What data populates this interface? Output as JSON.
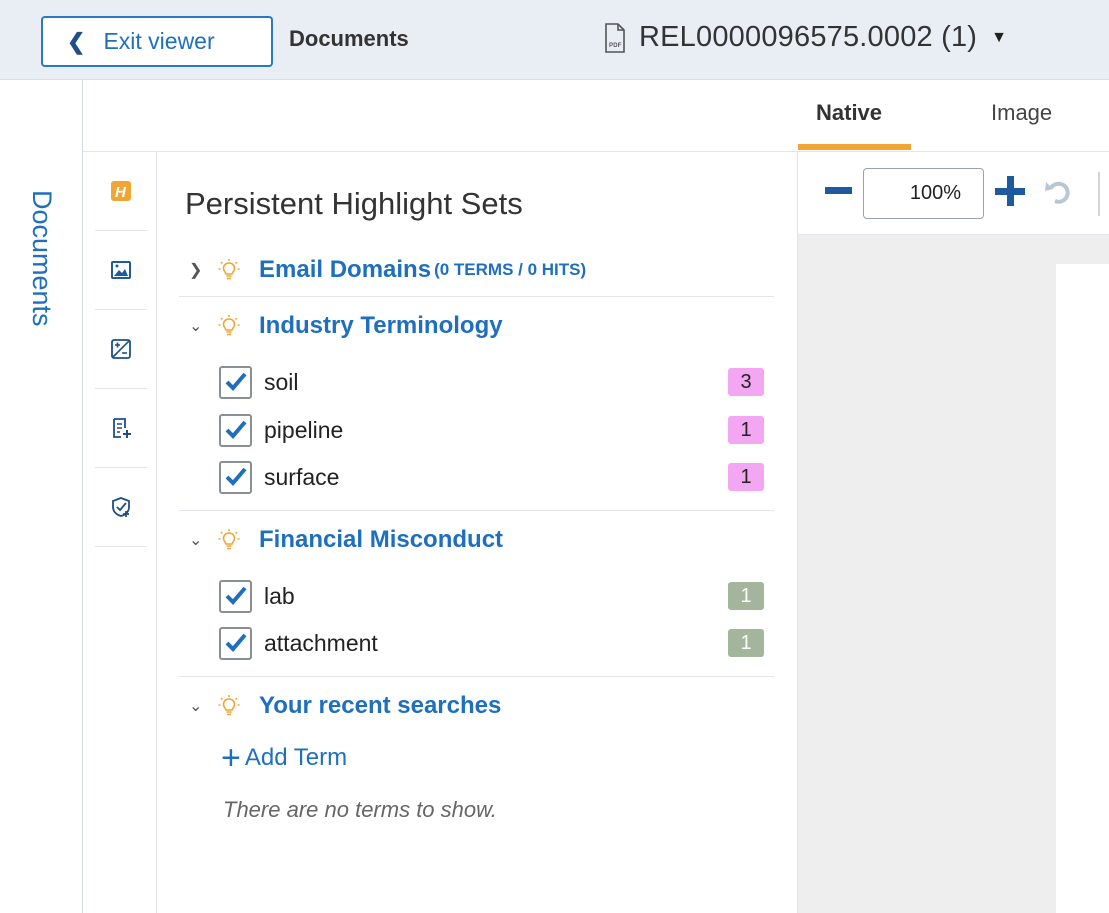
{
  "header": {
    "exit_label": "Exit viewer",
    "breadcrumb": "Documents",
    "doc_title": "REL0000096575.0002 (1)"
  },
  "side_tab": {
    "label": "Documents"
  },
  "panel": {
    "title": "Persistent Highlight Sets",
    "sections": [
      {
        "name": "Email Domains",
        "meta": "(0 TERMS / 0 HITS)",
        "expanded": false,
        "terms": []
      },
      {
        "name": "Industry Terminology",
        "meta": "",
        "expanded": true,
        "terms": [
          {
            "label": "soil",
            "count": "3",
            "badge_color": "#f3a6f1"
          },
          {
            "label": "pipeline",
            "count": "1",
            "badge_color": "#f3a6f1"
          },
          {
            "label": "surface",
            "count": "1",
            "badge_color": "#f3a6f1"
          }
        ]
      },
      {
        "name": "Financial Misconduct",
        "meta": "",
        "expanded": true,
        "terms": [
          {
            "label": "lab",
            "count": "1",
            "badge_color": "#a3b59a"
          },
          {
            "label": "attachment",
            "count": "1",
            "badge_color": "#a3b59a"
          }
        ]
      },
      {
        "name": "Your recent searches",
        "meta": "",
        "expanded": true,
        "terms": []
      }
    ],
    "add_term_label": "Add Term",
    "empty_note": "There are no terms to show."
  },
  "viewer": {
    "tabs": [
      "Native",
      "Image"
    ],
    "active_tab": "Native",
    "zoom": "100%"
  },
  "colors": {
    "accent": "#1f6fbf",
    "tab_underline": "#f0a534",
    "bulb": "#f0a534"
  },
  "icons": [
    "chevron-left-icon",
    "pdf-file-icon",
    "chevron-down-icon",
    "highlight-h-icon",
    "image-icon",
    "redact-icon",
    "notes-icon",
    "shield-icon",
    "bulb-icon",
    "rotate-icon"
  ]
}
